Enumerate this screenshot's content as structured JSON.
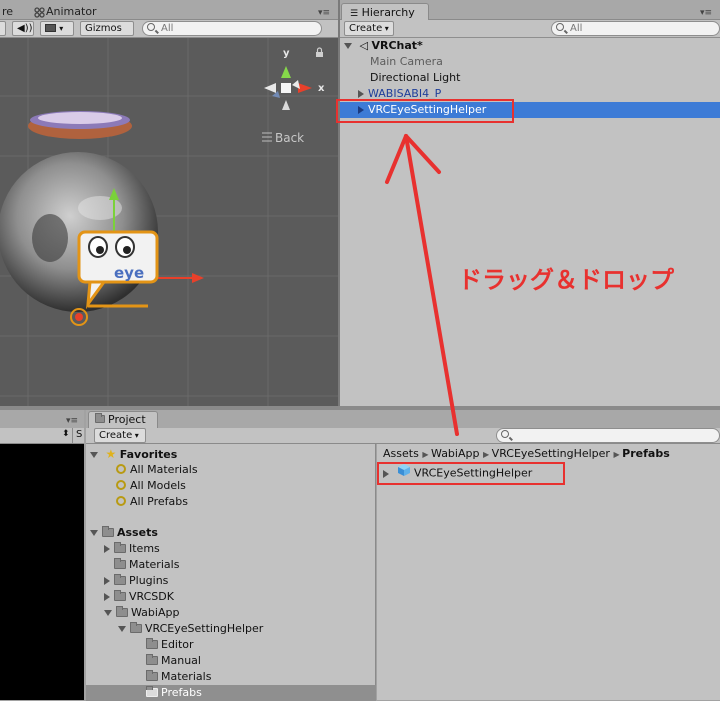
{
  "scene": {
    "tabs": [
      "re",
      "Animator"
    ],
    "gizmos_label": "Gizmos",
    "search_placeholder": "All",
    "back_label": "Back",
    "axis_y": "y",
    "axis_x": "x",
    "eye_label": "eye"
  },
  "hierarchy": {
    "tab_label": "Hierarchy",
    "create_label": "Create",
    "search_placeholder": "All",
    "scene_name": "VRChat*",
    "items": [
      {
        "label": "Main Camera",
        "state": "inactive"
      },
      {
        "label": "Directional Light",
        "state": "normal"
      },
      {
        "label": "WABISABI4_P",
        "state": "prefab"
      },
      {
        "label": "VRCEyeSettingHelper",
        "state": "selected"
      }
    ]
  },
  "annotation": {
    "text": "ドラッグ＆ドロップ",
    "color": "#e8312f"
  },
  "project": {
    "tab_label": "Project",
    "create_label": "Create",
    "favorites_label": "Favorites",
    "favorites": [
      "All Materials",
      "All Models",
      "All Prefabs"
    ],
    "assets_label": "Assets",
    "tree": [
      {
        "label": "Items",
        "depth": 1,
        "arrow": true
      },
      {
        "label": "Materials",
        "depth": 1,
        "arrow": false
      },
      {
        "label": "Plugins",
        "depth": 1,
        "arrow": true
      },
      {
        "label": "VRCSDK",
        "depth": 1,
        "arrow": true
      },
      {
        "label": "WabiApp",
        "depth": 1,
        "arrow": "open"
      },
      {
        "label": "VRCEyeSettingHelper",
        "depth": 2,
        "arrow": "open"
      },
      {
        "label": "Editor",
        "depth": 3,
        "arrow": false
      },
      {
        "label": "Manual",
        "depth": 3,
        "arrow": false
      },
      {
        "label": "Materials",
        "depth": 3,
        "arrow": false
      },
      {
        "label": "Prefabs",
        "depth": 3,
        "arrow": false,
        "selected": true
      }
    ],
    "breadcrumb": [
      "Assets",
      "WabiApp",
      "VRCEyeSettingHelper",
      "Prefabs"
    ],
    "asset_item": "VRCEyeSettingHelper"
  }
}
